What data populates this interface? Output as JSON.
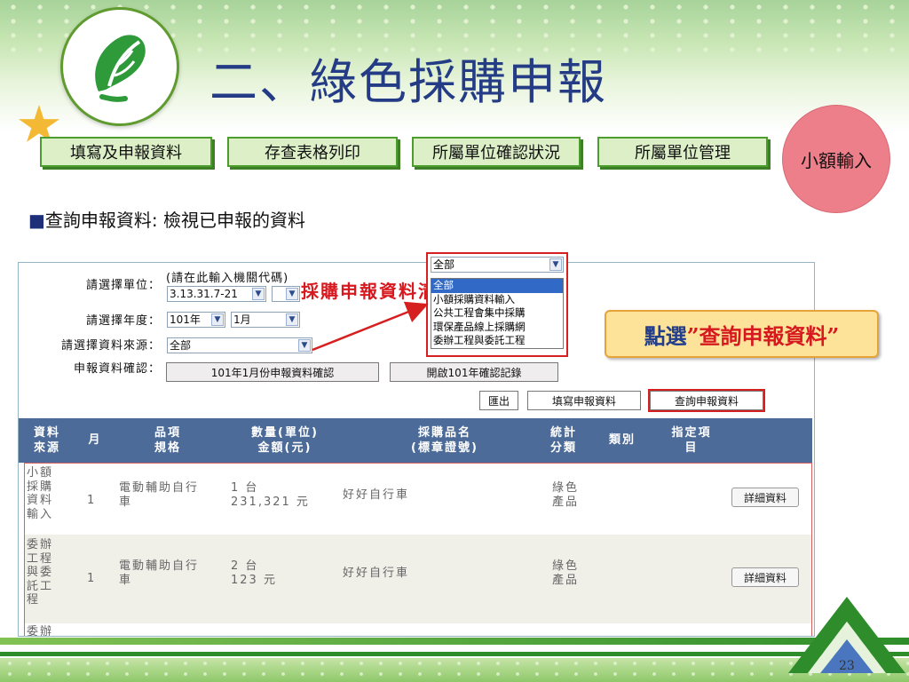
{
  "slide": {
    "title": "二、綠色採購申報",
    "subtitle_bullet": "■",
    "subtitle": "查詢申報資料: 檢視已申報的資料",
    "page_number": "23"
  },
  "nav": {
    "items": [
      {
        "label": "填寫及申報資料"
      },
      {
        "label": "存查表格列印"
      },
      {
        "label": "所屬單位確認狀況"
      },
      {
        "label": "所屬單位管理"
      }
    ],
    "circle_label": "小額輸入"
  },
  "form": {
    "unit_label": "請選擇單位：",
    "unit_hint": "(請在此輸入機關代碼)",
    "unit_code": "3.13.31.7-21",
    "unit_sub": "",
    "year_label": "請選擇年度：",
    "year_value": "101年",
    "month_value": "1月",
    "source_label": "請選擇資料來源：",
    "source_value": "全部",
    "confirm_label": "申報資料確認：",
    "confirm_button": "101年1月份申報資料確認",
    "open_button": "開啟101年確認記錄",
    "export_button": "匯出",
    "fill_button": "填寫申報資料",
    "query_button": "查詢申報資料"
  },
  "dropdown": {
    "selected": "全部",
    "options": [
      "全部",
      "小額採購資料輸入",
      "公共工程會集中採購",
      "環保產品線上採購網",
      "委辦工程與委託工程"
    ]
  },
  "callout": {
    "prefix": "點選",
    "highlight": "”查詢申報資料”"
  },
  "table": {
    "headers": {
      "source": [
        "資料",
        "來源"
      ],
      "month": "月",
      "item": [
        "品項",
        "規格"
      ],
      "qty": [
        "數量(單位)",
        "金額(元)"
      ],
      "name": [
        "採購品名",
        "(標章證號)"
      ],
      "stat": [
        "統計",
        "分類"
      ],
      "category": "類別",
      "designated": [
        "指定項",
        "目"
      ]
    },
    "rows": [
      {
        "source": [
          "小額",
          "採購",
          "資料",
          "輸入"
        ],
        "month": "1",
        "item": [
          "電動輔助自行",
          "車"
        ],
        "qty": "1 台",
        "amount": "231,321 元",
        "name": "好好自行車",
        "stat": [
          "綠色",
          "產品"
        ],
        "detail": "詳細資料"
      },
      {
        "source": [
          "委辦",
          "工程",
          "與委",
          "託工",
          "程"
        ],
        "month": "1",
        "item": [
          "電動輔助自行",
          "車"
        ],
        "qty": "2 台",
        "amount": "123 元",
        "name": "好好自行車",
        "stat": [
          "綠色",
          "產品"
        ],
        "detail": "詳細資料"
      }
    ],
    "partial_row_source": "委辦",
    "caption": "採購申報資料清單"
  },
  "colors": {
    "title": "#243b86",
    "nav_bg": "#dcefc7",
    "nav_border": "#4b9e2e",
    "circle": "#ec7f8a",
    "table_header": "#4d6b99",
    "highlight_red": "#d7191f"
  }
}
